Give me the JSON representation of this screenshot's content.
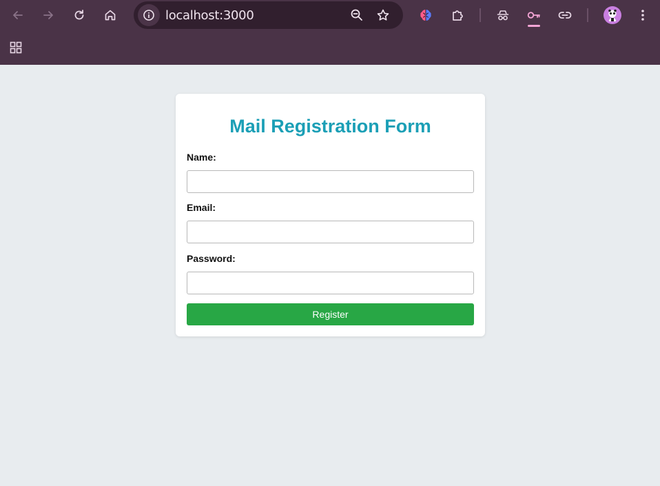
{
  "browser": {
    "url": "localhost:3000",
    "icons": {
      "back": "arrow-left-icon",
      "forward": "arrow-right-icon",
      "reload": "reload-icon",
      "home": "home-icon",
      "site_info": "info-icon",
      "zoom": "zoom-out-icon",
      "bookmark": "star-icon",
      "extension_brain": "brain-icon",
      "extensions": "puzzle-icon",
      "incognito": "incognito-icon",
      "passwords": "key-icon",
      "link": "link-icon",
      "profile": "avatar",
      "menu": "kebab-menu-icon",
      "apps": "apps-grid-icon"
    },
    "colors": {
      "frame": "#4a3347",
      "omnibox": "#311f2e",
      "key_accent": "#f5a5d6"
    }
  },
  "form": {
    "title": "Mail Registration Form",
    "name_label": "Name:",
    "name_value": "",
    "email_label": "Email:",
    "email_value": "",
    "password_label": "Password:",
    "password_value": "",
    "submit_label": "Register",
    "colors": {
      "title": "#1b9fb6",
      "button": "#28a745",
      "background": "#e8ecef"
    }
  }
}
